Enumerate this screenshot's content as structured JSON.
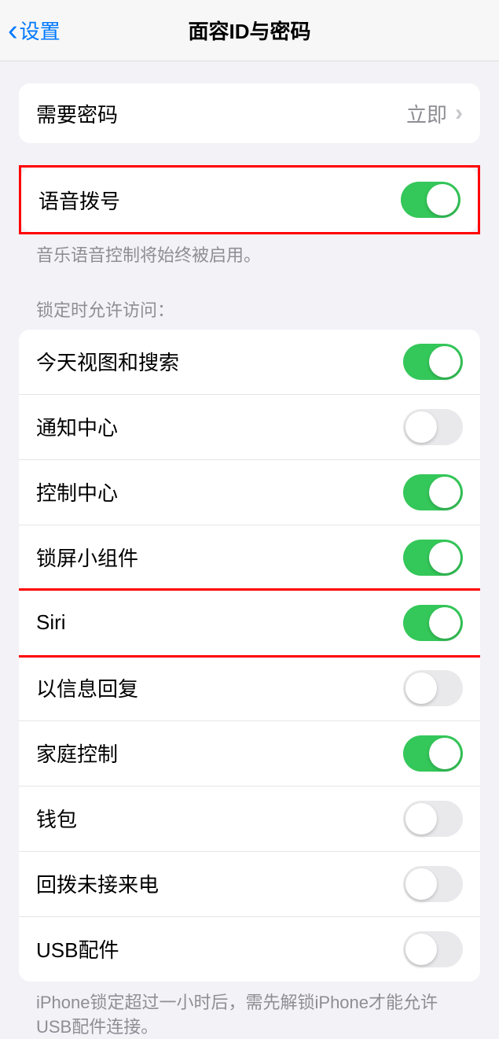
{
  "header": {
    "back_label": "设置",
    "title": "面容ID与密码"
  },
  "require_passcode": {
    "label": "需要密码",
    "value": "立即"
  },
  "voice_dial": {
    "label": "语音拨号",
    "enabled": true,
    "footer": "音乐语音控制将始终被启用。"
  },
  "lock_access": {
    "header": "锁定时允许访问：",
    "items": [
      {
        "label": "今天视图和搜索",
        "enabled": true
      },
      {
        "label": "通知中心",
        "enabled": false
      },
      {
        "label": "控制中心",
        "enabled": true
      },
      {
        "label": "锁屏小组件",
        "enabled": true
      },
      {
        "label": "Siri",
        "enabled": true
      },
      {
        "label": "以信息回复",
        "enabled": false
      },
      {
        "label": "家庭控制",
        "enabled": true
      },
      {
        "label": "钱包",
        "enabled": false
      },
      {
        "label": "回拨未接来电",
        "enabled": false
      },
      {
        "label": "USB配件",
        "enabled": false
      }
    ],
    "footer": "iPhone锁定超过一小时后，需先解锁iPhone才能允许USB配件连接。"
  }
}
